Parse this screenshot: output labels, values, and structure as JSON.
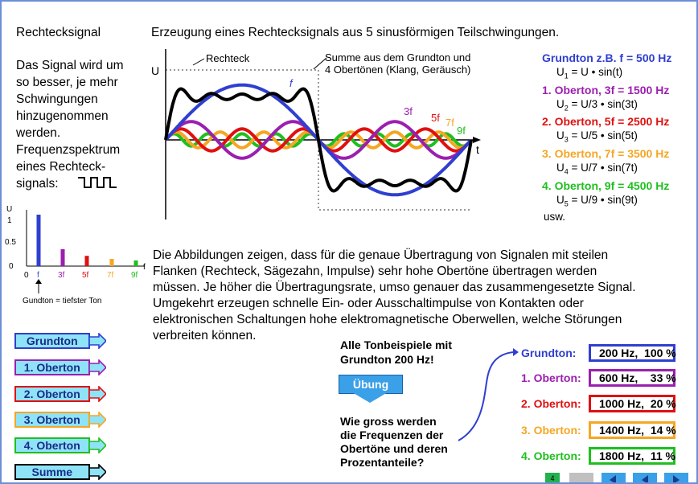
{
  "left_title": "Rechtecksignal",
  "main_title": "Erzeugung eines Rechtecksignals aus 5 sinusförmigen Teilschwingungen.",
  "intro_lines": [
    "Das Signal wird um",
    "so besser, je mehr",
    "Schwingungen",
    "hinzugenommen",
    "werden.",
    "Frequenzspektrum",
    "eines Rechteck-",
    "signals:"
  ],
  "main_graph": {
    "label_rechteck": "Rechteck",
    "label_summe_line1": "Summe aus dem Grundton und",
    "label_summe_line2": "4 Obertönen (Klang, Geräusch)",
    "label_u": "U",
    "label_t": "t",
    "label_f": "f",
    "label_3f": "3f",
    "label_5f": "5f",
    "label_7f": "7f",
    "label_9f": "9f"
  },
  "harmonics": [
    {
      "title": "Grundton z.B. f = 500 Hz",
      "sub": "1",
      "coef": "U",
      "arg": "t",
      "color": "#2f3fcf"
    },
    {
      "title": "1. Oberton, 3f = 1500 Hz",
      "sub": "2",
      "coef": "U/3",
      "arg": "3t",
      "color": "#9b1faf"
    },
    {
      "title": "2. Oberton, 5f = 2500 Hz",
      "sub": "3",
      "coef": "U/5",
      "arg": "5t",
      "color": "#e01010"
    },
    {
      "title": "3. Oberton, 7f = 3500 Hz",
      "sub": "4",
      "coef": "U/7",
      "arg": "7t",
      "color": "#f5a623"
    },
    {
      "title": "4. Oberton, 9f = 4500 Hz",
      "sub": "5",
      "coef": "U/9",
      "arg": "9t",
      "color": "#1fbf1f"
    }
  ],
  "formula_text": {
    "u": "U",
    "eq": " = ",
    "dot": " • sin(",
    "close": ")"
  },
  "usw": "usw.",
  "spectrum": {
    "y_label": "U",
    "y_ticks": [
      "1",
      "0.5",
      "0"
    ],
    "x_labels": [
      "0",
      "f",
      "3f",
      "5f",
      "7f",
      "9f"
    ],
    "x_axis_label": "f",
    "caption": "Gundton = tiefster Ton",
    "values": [
      1,
      0.33,
      0.2,
      0.14,
      0.11
    ],
    "colors": [
      "#2f3fcf",
      "#9b1faf",
      "#e01010",
      "#f5a623",
      "#1fbf1f"
    ]
  },
  "body_text_lines": [
    "Die Abbildungen zeigen, dass für die genaue Übertragung von Signalen mit steilen",
    "Flanken (Rechteck, Sägezahn, Impulse) sehr hohe Obertöne übertragen werden",
    "müssen. Je höher die Übertragungsrate, umso genauer das zusammengesetzte Signal.",
    "Umgekehrt erzeugen schnelle Ein- oder Ausschaltimpulse von Kontakten oder",
    "elektronischen Schaltungen hohe elektromagnetische Oberwellen, welche Störungen",
    "verbreiten können."
  ],
  "left_buttons": [
    {
      "label": "Grundton",
      "color": "#2f3fcf"
    },
    {
      "label": "1. Oberton",
      "color": "#9b1faf"
    },
    {
      "label": "2. Oberton",
      "color": "#e01010"
    },
    {
      "label": "3. Oberton",
      "color": "#f5a623"
    },
    {
      "label": "4. Oberton",
      "color": "#1fbf1f"
    },
    {
      "label": "Summe",
      "color": "#000000"
    }
  ],
  "exercise": {
    "note_line1": "Alle Tonbeispiele mit",
    "note_line2": "Grundton 200 Hz!",
    "button": "Übung",
    "question_lines": [
      "Wie gross werden",
      "die Frequenzen der",
      "Obertöne und deren",
      "Prozentanteile?"
    ]
  },
  "answers": [
    {
      "label": "Grundton:",
      "value": "200 Hz,  100 %",
      "color": "#2f3fcf"
    },
    {
      "label": "1. Oberton:",
      "value": "600 Hz,    33 %",
      "color": "#9b1faf"
    },
    {
      "label": "2. Oberton:",
      "value": "1000 Hz,  20 %",
      "color": "#e01010"
    },
    {
      "label": "3. Oberton:",
      "value": "1400 Hz,  14 %",
      "color": "#f5a623"
    },
    {
      "label": "4. Oberton:",
      "value": "1800 Hz,  11 %",
      "color": "#1fbf1f"
    }
  ],
  "nav": {
    "page_marker": "4"
  }
}
